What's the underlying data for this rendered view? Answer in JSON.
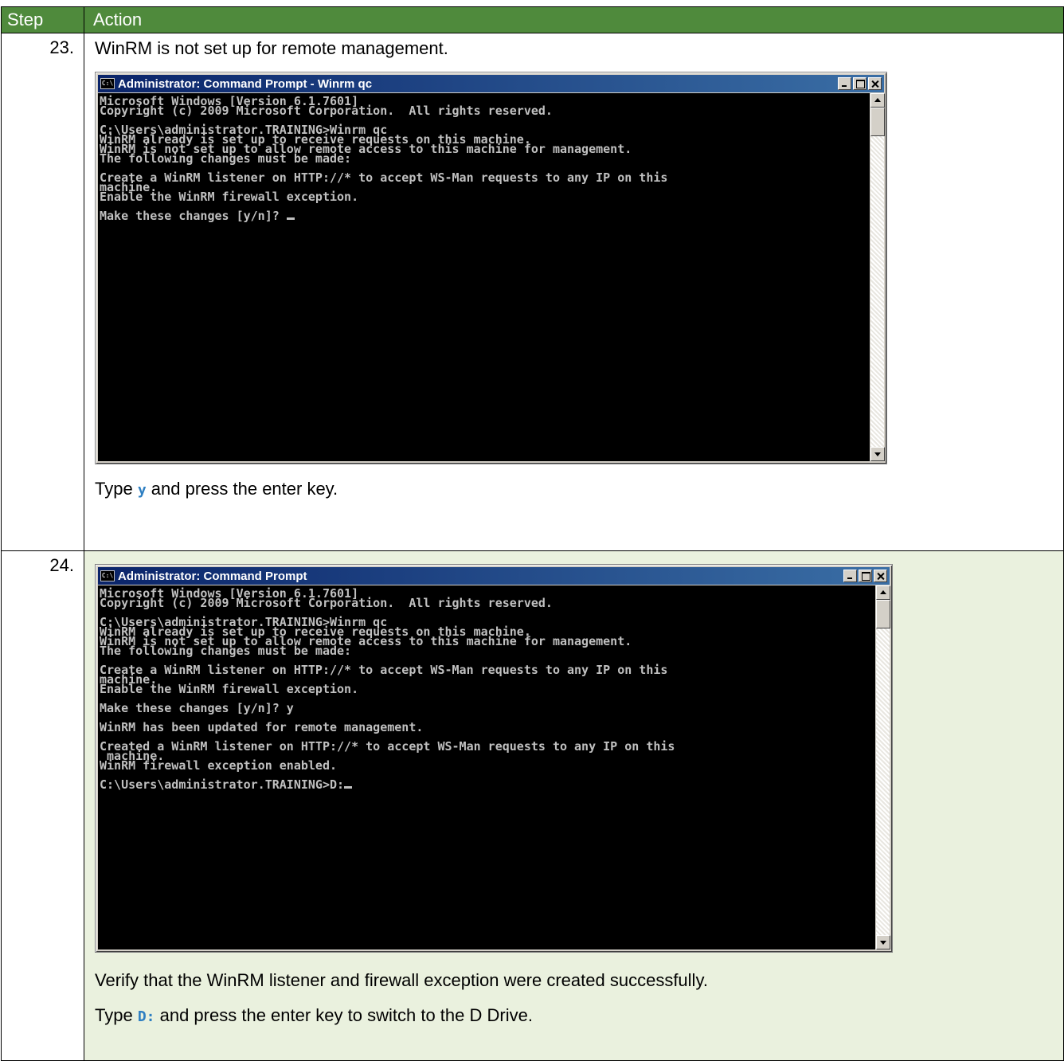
{
  "table": {
    "header": {
      "step": "Step",
      "action": "Action"
    },
    "rows": [
      {
        "step": "23.",
        "intro": "WinRM is not set up for remote management.",
        "window": {
          "title": "Administrator: Command Prompt - Winrm  qc",
          "icon": "console-icon",
          "lines": [
            "Microsoft Windows [Version 6.1.7601]",
            "Copyright (c) 2009 Microsoft Corporation.  All rights reserved.",
            "",
            "C:\\Users\\administrator.TRAINING>Winrm qc",
            "WinRM already is set up to receive requests on this machine.",
            "WinRM is not set up to allow remote access to this machine for management.",
            "The following changes must be made:",
            "",
            "Create a WinRM listener on HTTP://* to accept WS-Man requests to any IP on this",
            "machine.",
            "Enable the WinRM firewall exception.",
            "",
            "Make these changes [y/n]? "
          ]
        },
        "instruction": {
          "before": "Type ",
          "key": "y",
          "after": " and press the enter key."
        }
      },
      {
        "step": "24.",
        "window": {
          "title": "Administrator: Command Prompt",
          "icon": "console-icon",
          "lines": [
            "Microsoft Windows [Version 6.1.7601]",
            "Copyright (c) 2009 Microsoft Corporation.  All rights reserved.",
            "",
            "C:\\Users\\administrator.TRAINING>Winrm qc",
            "WinRM already is set up to receive requests on this machine.",
            "WinRM is not set up to allow remote access to this machine for management.",
            "The following changes must be made:",
            "",
            "Create a WinRM listener on HTTP://* to accept WS-Man requests to any IP on this",
            "machine.",
            "Enable the WinRM firewall exception.",
            "",
            "Make these changes [y/n]? y",
            "",
            "WinRM has been updated for remote management.",
            "",
            "Created a WinRM listener on HTTP://* to accept WS-Man requests to any IP on this",
            " machine.",
            "WinRM firewall exception enabled.",
            "",
            "C:\\Users\\administrator.TRAINING>D:"
          ]
        },
        "verify": "Verify that the WinRM listener and firewall exception were created successfully.",
        "instruction": {
          "before": "Type ",
          "key": "D:",
          "after": " and press the enter key to switch to the D Drive."
        }
      }
    ]
  },
  "colors": {
    "header_bg": "#4f8a3c",
    "row24_bg": "#eaf1de",
    "key_text": "#2e7fc2"
  }
}
